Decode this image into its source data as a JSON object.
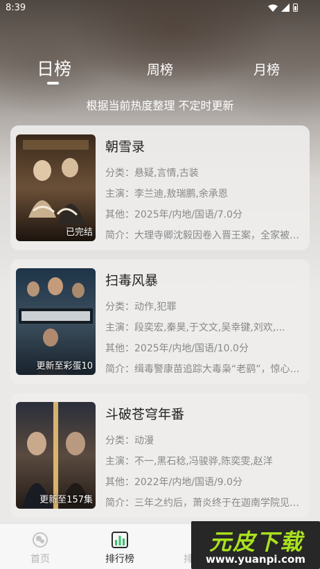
{
  "status_bar": {
    "time": "8:39"
  },
  "tabs": [
    {
      "label": "日榜",
      "active": true
    },
    {
      "label": "周榜",
      "active": false
    },
    {
      "label": "月榜",
      "active": false
    }
  ],
  "subtitle": "根据当前热度整理 不定时更新",
  "items": [
    {
      "title": "朝雪录",
      "category": "分类：悬疑,言情,古装",
      "cast": "主演：李兰迪,敖瑞鹏,余承恩",
      "other": "其他：2025年/内地/国语/7.0分",
      "intro": "简介：大理寺卿沈毅因卷入晋王案，全家被抄斩...",
      "badge": "已完结"
    },
    {
      "title": "扫毒风暴",
      "category": "分类：动作,犯罪",
      "cast": "主演：段奕宏,秦昊,于文文,吴幸键,刘欢,...",
      "other": "其他：2025年/内地/国语/10.0分",
      "intro": "简介：缉毒警康苗追踪大毒枭“老鹞”，惊心动魄...",
      "badge": "更新至彩蛋10"
    },
    {
      "title": "斗破苍穹年番",
      "category": "分类：动漫",
      "cast": "主演：不一,黑石稔,冯骏骅,陈奕雯,赵洋",
      "other": "其他：2022年/内地/国语/9.0分",
      "intro": "简介：三年之约后，萧炎终于在迦南学院见到...",
      "badge": "更新至157集"
    }
  ],
  "bottom_nav": [
    {
      "label": "首页",
      "icon": "home-icon",
      "active": false
    },
    {
      "label": "排行榜",
      "icon": "ranking-icon",
      "active": true
    },
    {
      "label": "排",
      "icon": "",
      "active": false
    }
  ],
  "watermark": {
    "title": "元皮下载",
    "url": "www.yuanpi.com"
  },
  "colors": {
    "active_nav": "#333333",
    "inactive_nav": "#b3b3b3",
    "watermark_green": "#a9e21d"
  }
}
